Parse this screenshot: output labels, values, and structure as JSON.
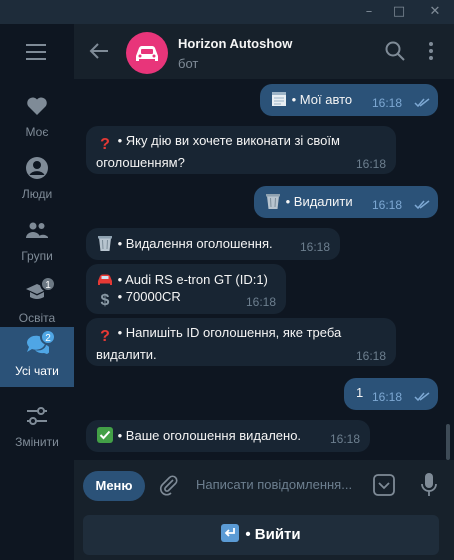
{
  "window": {
    "minimize_icon": "minimize-icon",
    "maximize_icon": "maximize-icon",
    "close_icon": "close-icon"
  },
  "rail": {
    "menu_icon": "hamburger-menu-icon",
    "items": [
      {
        "label": "Моє",
        "icon": "heart-icon",
        "badge": "",
        "active": false
      },
      {
        "label": "Люди",
        "icon": "person-icon",
        "badge": "",
        "active": false
      },
      {
        "label": "Групи",
        "icon": "group-icon",
        "badge": "",
        "active": false
      },
      {
        "label": "Освіта",
        "icon": "graduation-cap-icon",
        "badge": "1",
        "active": false
      },
      {
        "label": "Усі чати",
        "icon": "chats-icon",
        "badge": "2",
        "active": true
      },
      {
        "label": "Змінити",
        "icon": "sliders-icon",
        "badge": "",
        "active": false
      }
    ]
  },
  "header": {
    "title": "Horizon Autoshow",
    "subtitle": "бот",
    "avatar_color": "#e8357a"
  },
  "messages": [
    {
      "direction": "out",
      "emoji": "notepad",
      "text": "• Мої авто",
      "time": "16:18",
      "read": true
    },
    {
      "direction": "in",
      "emoji": "question",
      "text_lines": [
        "• Яку дію ви хочете виконати зі своїм",
        "оголошенням?"
      ],
      "time": "16:18"
    },
    {
      "direction": "out",
      "emoji": "wastebasket",
      "text": "• Видалити",
      "time": "16:18",
      "read": true
    },
    {
      "direction": "in",
      "emoji": "wastebasket",
      "text": "• Видалення оголошення.",
      "time": "16:18"
    },
    {
      "direction": "in",
      "emoji_lines": [
        "car",
        "dollar"
      ],
      "text_lines": [
        "• Audi RS e-tron GT (ID:1)",
        "• 70000CR"
      ],
      "time": "16:18"
    },
    {
      "direction": "in",
      "emoji": "question",
      "text_lines": [
        "• Напишіть ID оголошення, яке треба",
        "видалити."
      ],
      "time": "16:18"
    },
    {
      "direction": "out",
      "text": "1",
      "time": "16:18",
      "read": true
    },
    {
      "direction": "in",
      "emoji": "check",
      "text": "• Ваше оголошення видалено.",
      "time": "16:18"
    }
  ],
  "composer": {
    "menu_label": "Меню",
    "placeholder": "Написати повідомлення...",
    "attach_icon": "paperclip-icon",
    "keyboard_icon": "keyboard-toggle-icon",
    "mic_icon": "microphone-icon"
  },
  "reply_keyboard": {
    "button_label": "• Вийти",
    "button_emoji": "return-arrow"
  },
  "colors": {
    "accent": "#2b5278",
    "bg": "#0e1621",
    "panel": "#17212b",
    "incoming": "#182533",
    "badge_active": "#4fa6e5"
  }
}
